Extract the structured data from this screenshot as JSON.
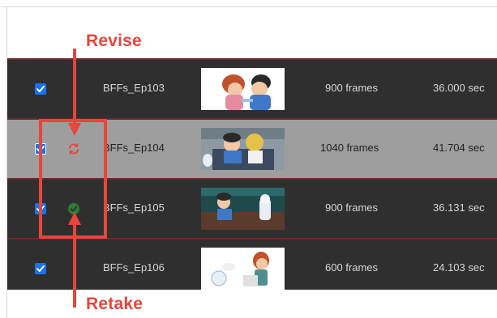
{
  "callouts": {
    "revise": "Revise",
    "retake": "Retake"
  },
  "colors": {
    "accent_red": "#e8453c",
    "checkbox_blue": "#1a73e8",
    "row_dark": "#2f2f2f",
    "row_selected": "#9e9e9e",
    "separator": "#6b2a27",
    "retake_green": "#2e7d32"
  },
  "scenes": [
    {
      "checked": true,
      "status_icon": "",
      "name": "BFFs_Ep103",
      "thumbnail": "cartoon-thumbnail-ep103",
      "frames": "900 frames",
      "duration": "36.000 sec"
    },
    {
      "checked": true,
      "status_icon": "revise-icon",
      "name": "BFFs_Ep104",
      "thumbnail": "cartoon-thumbnail-ep104",
      "frames": "1040 frames",
      "duration": "41.704 sec",
      "selected": true
    },
    {
      "checked": true,
      "status_icon": "retake-icon",
      "name": "BFFs_Ep105",
      "thumbnail": "cartoon-thumbnail-ep105",
      "frames": "900 frames",
      "duration": "36.131 sec"
    },
    {
      "checked": true,
      "status_icon": "",
      "name": "BFFs_Ep106",
      "thumbnail": "cartoon-thumbnail-ep106",
      "frames": "600 frames",
      "duration": "24.103 sec"
    }
  ]
}
